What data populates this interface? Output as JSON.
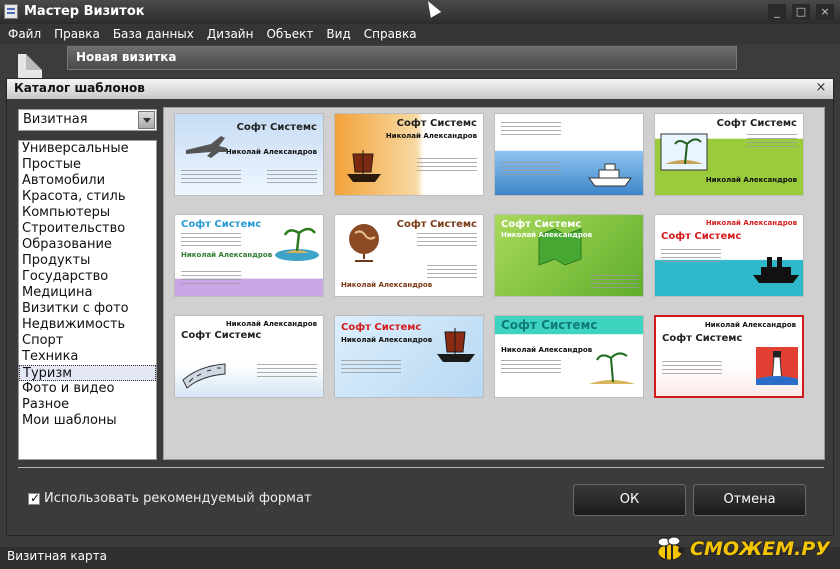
{
  "app": {
    "title": "Мастер Визиток"
  },
  "menu": [
    "Файл",
    "Правка",
    "База данных",
    "Дизайн",
    "Объект",
    "Вид",
    "Справка"
  ],
  "window": {
    "minimize": "_",
    "maximize": "□",
    "close": "×"
  },
  "background": {
    "new_card_title": "Новая визитка"
  },
  "dialog": {
    "title": "Каталог шаблонов",
    "close": "×",
    "format_combo": "Визитная",
    "categories": [
      "Универсальные",
      "Простые",
      "Автомобили",
      "Красота, стиль",
      "Компьютеры",
      "Строительство",
      "Образование",
      "Продукты",
      "Государство",
      "Медицина",
      "Визитки с фото",
      "Недвижимость",
      "Спорт",
      "Техника",
      "Туризм",
      "Фото и видео",
      "Разное",
      "Мои шаблоны"
    ],
    "selected_category": "Туризм",
    "checkbox_label": "Использовать рекомендуемый формат",
    "checkbox_checked": true,
    "ok_label": "ОК",
    "cancel_label": "Отмена"
  },
  "cards": [
    {
      "company": "Софт Системс",
      "name": "Николай Александров",
      "picture": "airplane",
      "selected": false
    },
    {
      "company": "Софт Системс",
      "name": "Николай Александров",
      "picture": "sailing-ship",
      "selected": false
    },
    {
      "company": "Софт Системс",
      "name": "Николай Александров",
      "picture": "cruise-ship",
      "selected": false
    },
    {
      "company": "Софт Системс",
      "name": "Николай Александров",
      "picture": "island",
      "selected": false
    },
    {
      "company": "Софт Системс",
      "name": "Николай Александров",
      "picture": "palm-island",
      "selected": false
    },
    {
      "company": "Софт Системс",
      "name": "Николай Александров",
      "picture": "globe",
      "selected": false
    },
    {
      "company": "Софт Системс",
      "name": "Николай Александров",
      "picture": "green-map",
      "selected": false
    },
    {
      "company": "Софт Системс",
      "name": "Николай Александров",
      "picture": "ocean-liner",
      "selected": false
    },
    {
      "company": "Софт Системс",
      "name": "Николай Александров",
      "picture": "film-strip",
      "selected": false
    },
    {
      "company": "Софт Системс",
      "name": "Николай Александров",
      "picture": "sailing-ship",
      "selected": false
    },
    {
      "company": "Софт Системс",
      "name": "Николай Александров",
      "picture": "palm-beach",
      "selected": false
    },
    {
      "company": "Софт Системс",
      "name": "Николай Александров",
      "picture": "lighthouse",
      "selected": true
    }
  ],
  "status": {
    "text": "Визитная карта"
  },
  "logo": {
    "text": "СМОЖЕМ.РУ"
  },
  "colors": {
    "accent_red": "#d21a1a",
    "panel": "#d0d0d0",
    "logo_yellow": "#f5c400"
  }
}
